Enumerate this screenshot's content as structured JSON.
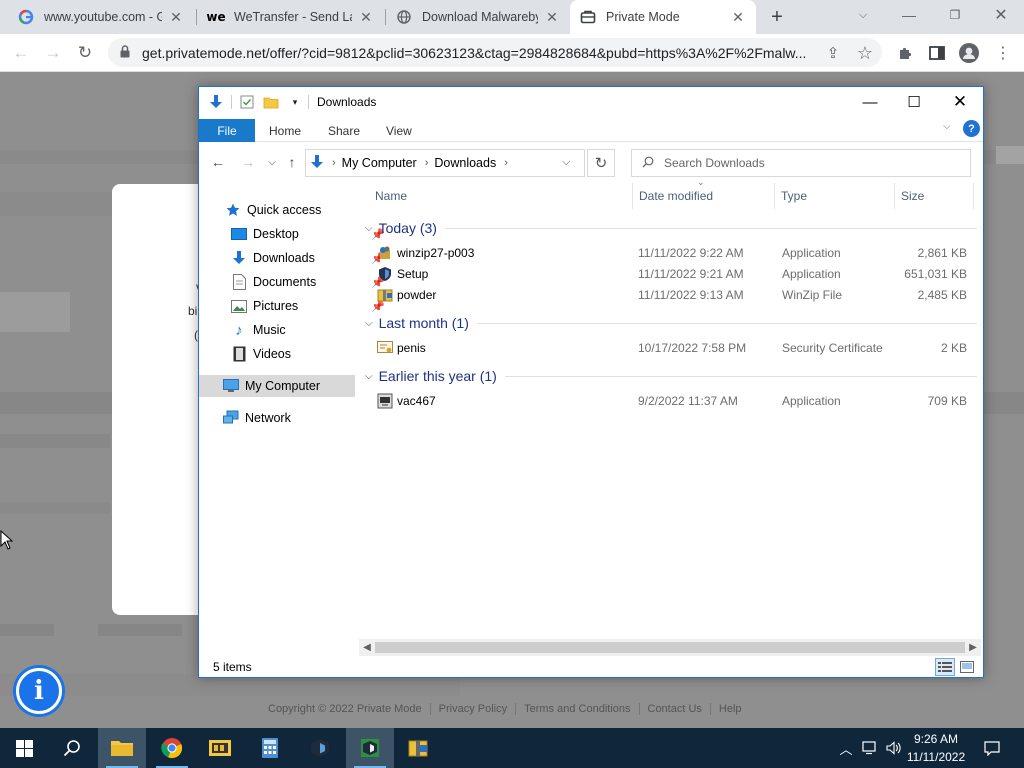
{
  "browser": {
    "tabs": [
      {
        "title": "www.youtube.com - Gr",
        "favicon": "google-g-icon"
      },
      {
        "title": "WeTransfer - Send Larg",
        "favicon": "wetransfer-icon"
      },
      {
        "title": "Download Malwarebyt",
        "favicon": "globe-icon"
      },
      {
        "title": "Private Mode",
        "favicon": "private-mode-icon",
        "active": true
      }
    ],
    "url": "get.privatemode.net/offer/?cid=9812&pclid=30623123&ctag=2984828684&pubd=https%3A%2F%2Fmalw..."
  },
  "webpage": {
    "footer": [
      "Copyright © 2022 Private Mode",
      "Privacy Policy",
      "Terms and Conditions",
      "Contact Us",
      "Help"
    ],
    "info_button": "i",
    "partial_text": [
      "v",
      "bi",
      "("
    ]
  },
  "explorer": {
    "title": "Downloads",
    "ribbon_tabs": [
      "File",
      "Home",
      "Share",
      "View"
    ],
    "breadcrumb": [
      "My Computer",
      "Downloads"
    ],
    "search_placeholder": "Search Downloads",
    "nav": [
      {
        "label": "Quick access",
        "icon": "star-icon"
      },
      {
        "label": "Desktop",
        "icon": "desktop-icon",
        "pinned": true
      },
      {
        "label": "Downloads",
        "icon": "download-arrow-icon",
        "pinned": true
      },
      {
        "label": "Documents",
        "icon": "documents-icon",
        "pinned": true
      },
      {
        "label": "Pictures",
        "icon": "pictures-icon",
        "pinned": true
      },
      {
        "label": "Music",
        "icon": "music-icon"
      },
      {
        "label": "Videos",
        "icon": "videos-icon"
      },
      {
        "label": "My Computer",
        "icon": "computer-icon",
        "selected": true
      },
      {
        "label": "Network",
        "icon": "network-icon"
      }
    ],
    "columns": [
      "Name",
      "Date modified",
      "Type",
      "Size"
    ],
    "groups": [
      {
        "label": "Today (3)",
        "files": [
          {
            "name": "winzip27-p003",
            "date": "11/11/2022 9:22 AM",
            "type": "Application",
            "size": "2,861 KB",
            "icon": "installer-icon"
          },
          {
            "name": "Setup",
            "date": "11/11/2022 9:21 AM",
            "type": "Application",
            "size": "651,031 KB",
            "icon": "shield-app-icon"
          },
          {
            "name": "powder",
            "date": "11/11/2022 9:13 AM",
            "type": "WinZip File",
            "size": "2,485 KB",
            "icon": "zip-file-icon"
          }
        ]
      },
      {
        "label": "Last month (1)",
        "files": [
          {
            "name": "penis",
            "date": "10/17/2022 7:58 PM",
            "type": "Security Certificate",
            "size": "2 KB",
            "icon": "certificate-icon"
          }
        ]
      },
      {
        "label": "Earlier this year (1)",
        "files": [
          {
            "name": "vac467",
            "date": "9/2/2022 11:37 AM",
            "type": "Application",
            "size": "709 KB",
            "icon": "app-exe-icon"
          }
        ]
      }
    ],
    "status": "5 items"
  },
  "taskbar": {
    "time": "9:26 AM",
    "date": "11/11/2022"
  }
}
